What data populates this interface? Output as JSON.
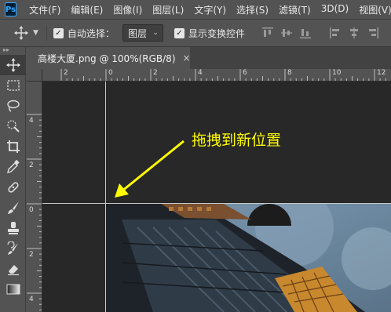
{
  "app": {
    "logo": "Ps"
  },
  "menu": [
    "文件(F)",
    "编辑(E)",
    "图像(I)",
    "图层(L)",
    "文字(Y)",
    "选择(S)",
    "滤镜(T)",
    "3D(D)",
    "视图(V)"
  ],
  "options": {
    "auto_select_label": "自动选择：",
    "auto_select_value": "图层",
    "show_transform_label": "显示变换控件"
  },
  "document": {
    "tab_title": "高楼大厦.png @ 100%(RGB/8)",
    "close_glyph": "×"
  },
  "ruler_top_ticks": [
    "2",
    "0",
    "2",
    "4",
    "6",
    "8",
    "10",
    "12"
  ],
  "ruler_left_ticks": [
    "4",
    "2",
    "0",
    "2",
    "4"
  ],
  "annotation": {
    "text": "拖拽到新位置",
    "color": "#fffd00"
  },
  "tools": [
    "move-tool",
    "marquee-tool",
    "lasso-tool",
    "quick-selection-tool",
    "crop-tool",
    "eyedropper-tool",
    "healing-brush-tool",
    "brush-tool",
    "clone-stamp-tool",
    "history-brush-tool",
    "eraser-tool",
    "gradient-tool"
  ]
}
